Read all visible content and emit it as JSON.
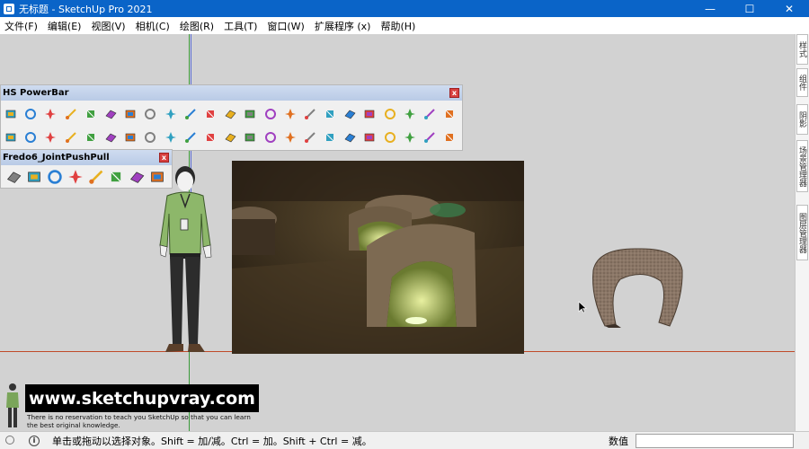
{
  "window": {
    "title": "无标题 - SketchUp Pro 2021",
    "minimize": "—",
    "maximize": "☐",
    "close": "✕"
  },
  "menu": [
    "文件(F)",
    "编辑(E)",
    "视图(V)",
    "相机(C)",
    "绘图(R)",
    "工具(T)",
    "窗口(W)",
    "扩展程序 (x)",
    "帮助(H)"
  ],
  "toolbars": {
    "powerbar": {
      "title": "HS PowerBar",
      "close": "x"
    },
    "joint": {
      "title": "Fredo6_JointPushPull",
      "close": "x"
    }
  },
  "right_panel_tabs": [
    "样式",
    "组件",
    "阴影",
    "场景管理器",
    "图层管理器"
  ],
  "watermark": {
    "url": "www.sketchupvray.com",
    "line1": "There is no reservation to teach you SketchUp so that you can learn",
    "line2": "the best original knowledge."
  },
  "status": {
    "message": "单击或拖动以选择对象。Shift = 加/减。Ctrl = 加。Shift + Ctrl = 减。",
    "value_label": "数值"
  },
  "colors": {
    "titlebar": "#0a64c8",
    "axis_red": "#c04a2a",
    "axis_green": "#3a9a3a",
    "axis_blue": "#5a6ed0"
  }
}
